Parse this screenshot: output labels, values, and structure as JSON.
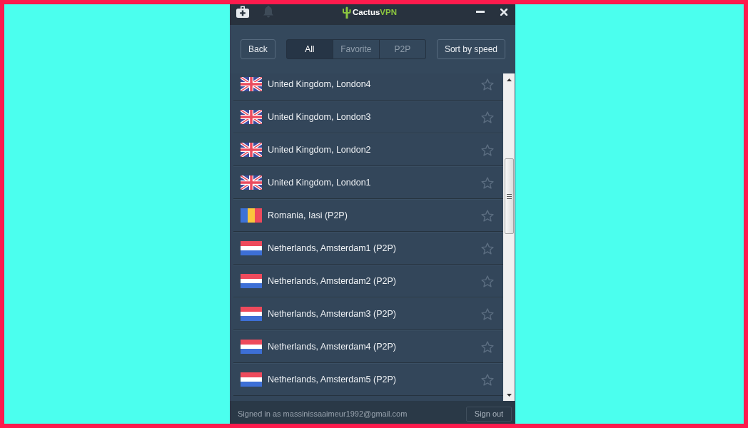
{
  "title_bar": {
    "logo": {
      "name": "Cactus",
      "accent": "VPN"
    }
  },
  "toolbar": {
    "back": "Back",
    "filters": [
      {
        "label": "All",
        "selected": true
      },
      {
        "label": "Favorite",
        "selected": false
      },
      {
        "label": "P2P",
        "selected": false
      }
    ],
    "sort": "Sort by speed"
  },
  "servers": [
    {
      "name": "United Kingdom, London4",
      "kind": "uk",
      "favorite": false
    },
    {
      "name": "United Kingdom, London3",
      "kind": "uk",
      "favorite": false
    },
    {
      "name": "United Kingdom, London2",
      "kind": "uk",
      "favorite": false
    },
    {
      "name": "United Kingdom, London1",
      "kind": "uk",
      "favorite": false
    },
    {
      "name": "Romania, Iasi (P2P)",
      "kind": "romania",
      "favorite": false
    },
    {
      "name": "Netherlands, Amsterdam1 (P2P)",
      "kind": "netherlands",
      "favorite": false
    },
    {
      "name": "Netherlands, Amsterdam2 (P2P)",
      "kind": "netherlands",
      "favorite": false
    },
    {
      "name": "Netherlands, Amsterdam3 (P2P)",
      "kind": "netherlands",
      "favorite": false
    },
    {
      "name": "Netherlands, Amsterdam4 (P2P)",
      "kind": "netherlands",
      "favorite": false
    },
    {
      "name": "Netherlands, Amsterdam5 (P2P)",
      "kind": "netherlands",
      "favorite": false
    }
  ],
  "footer": {
    "account": "Signed in as massinissaaimeur1992@gmail.com",
    "sign_out": "Sign out"
  }
}
